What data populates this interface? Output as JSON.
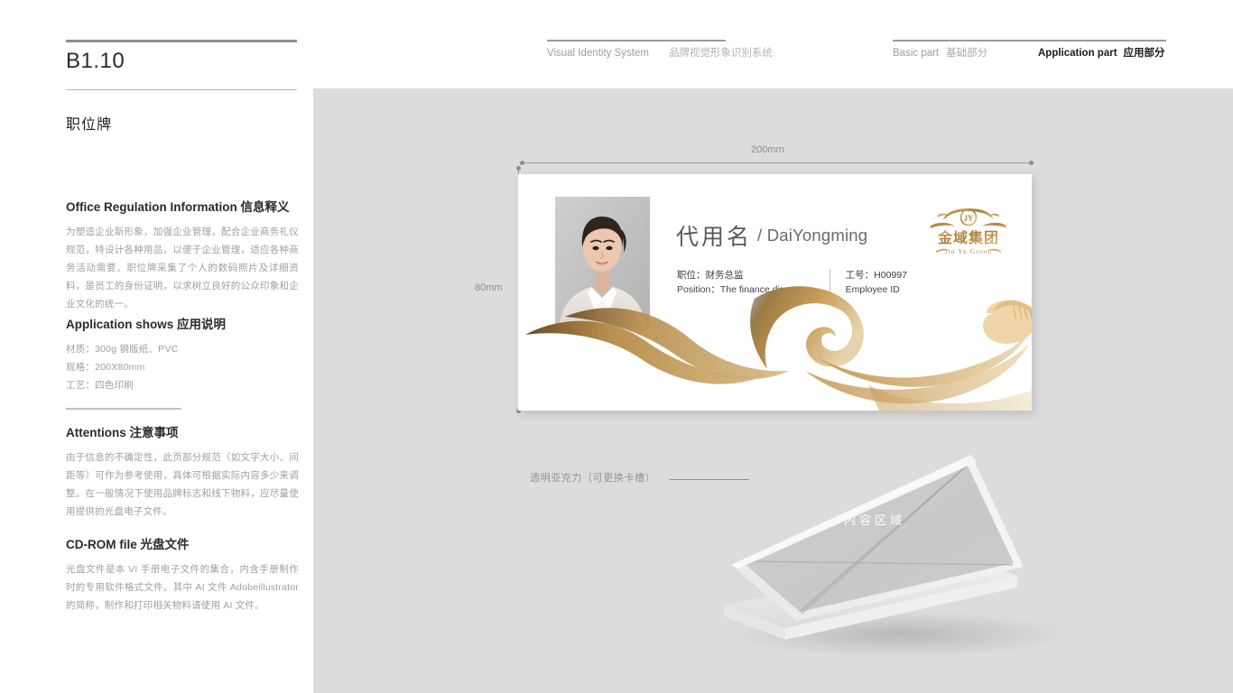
{
  "sidebar": {
    "page_code": "B1.10",
    "page_title": "职位牌",
    "divider_color": "#b9b9b9",
    "blocks": [
      {
        "heading_en": "Office Regulation Information",
        "heading_cn": "信息释义",
        "body": "为塑造企业新形象，加强企业管理，配合企业商务礼仪规范，特设计各种用品，以便于企业管理，适应各种商务活动需要。职位牌采集了个人的数码照片及详细资料，是员工的身份证明，以求树立良好的公众印象和企业文化的统一。"
      },
      {
        "heading_en": "Application shows",
        "heading_cn": "应用说明",
        "specs": [
          "材质：300g 钢版纸、PVC",
          "规格：200X80mm",
          "工艺：四色印刷"
        ]
      },
      {
        "heading_en": "Attentions",
        "heading_cn": "注意事项",
        "body": "由于信息的不确定性，此页部分规范（如文字大小、间距等）可作为参考使用，具体可根据实际内容多少来调整。在一般情况下使用品牌标志和线下物料，应尽量使用提供的光盘电子文件。"
      },
      {
        "heading_en": "CD-ROM file",
        "heading_cn": "光盘文件",
        "body": "光盘文件是本 VI 手册电子文件的集合，内含手册制作时的专用软件格式文件。其中 AI 文件 Adobeillustrator 的简称，制作和打印相关物料请使用 AI 文件。"
      }
    ]
  },
  "header": {
    "vis_en": "Visual Identity System",
    "vis_cn": "品牌视觉形象识别系统",
    "basic_en": "Basic part",
    "basic_cn": "基础部分",
    "app_en": "Application part",
    "app_cn": "应用部分"
  },
  "stage": {
    "background": "#dcdcdc",
    "dim_width": "200mm",
    "dim_height": "80mm"
  },
  "card": {
    "name_cn": "代用名",
    "name_en": "/ DaiYongming",
    "position_cn": "职位：财务总监",
    "position_en": "Position：The finance director",
    "employee_cn": "工号：H00997",
    "employee_en": "Employee ID",
    "logo_cn": "金域集团",
    "logo_en": "Jin Yu Group",
    "logo_monogram": "JY",
    "accent_gold": "#c79a57",
    "background": "#ffffff"
  },
  "stand": {
    "label": "透明亚克力（可更换卡槽）",
    "content_area": "内容区域"
  }
}
